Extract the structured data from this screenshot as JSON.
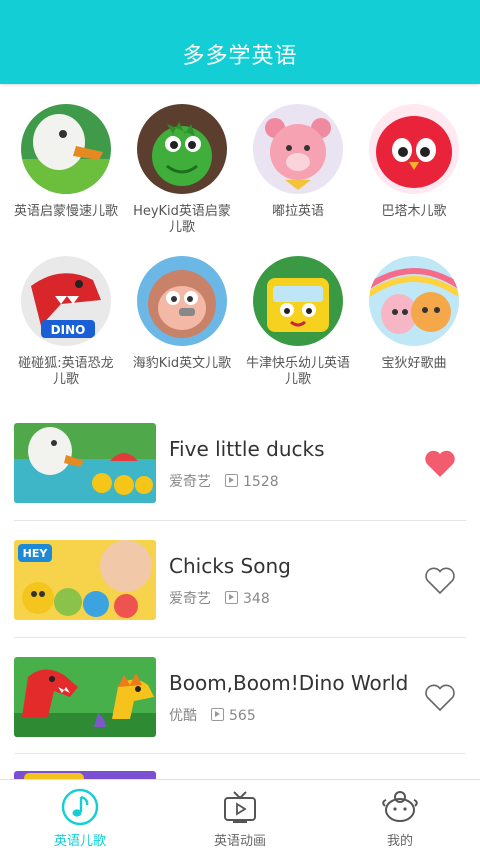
{
  "header": {
    "title": "多多学英语"
  },
  "categories": [
    {
      "label": "英语启蒙慢速儿歌"
    },
    {
      "label": "HeyKid英语启蒙儿歌"
    },
    {
      "label": "嘟拉英语"
    },
    {
      "label": "巴塔木儿歌"
    },
    {
      "label": "碰碰狐:英语恐龙儿歌"
    },
    {
      "label": "海豹Kid英文儿歌"
    },
    {
      "label": "牛津快乐幼儿英语儿歌"
    },
    {
      "label": "宝狄好歌曲"
    }
  ],
  "videos": [
    {
      "title": "Five little ducks",
      "source": "爱奇艺",
      "plays": "1528",
      "favorited": true
    },
    {
      "title": "Chicks Song",
      "source": "爱奇艺",
      "plays": "348",
      "favorited": false
    },
    {
      "title": "Boom,Boom!Dino World",
      "source": "优酷",
      "plays": "565",
      "favorited": false
    }
  ],
  "tabs": [
    {
      "label": "英语儿歌",
      "icon": "music-note-icon",
      "active": true
    },
    {
      "label": "英语动画",
      "icon": "tv-icon",
      "active": false
    },
    {
      "label": "我的",
      "icon": "profile-icon",
      "active": false
    }
  ],
  "colors": {
    "accent": "#13cfd5",
    "heart_active": "#f25c6e",
    "text_secondary": "#888888"
  }
}
